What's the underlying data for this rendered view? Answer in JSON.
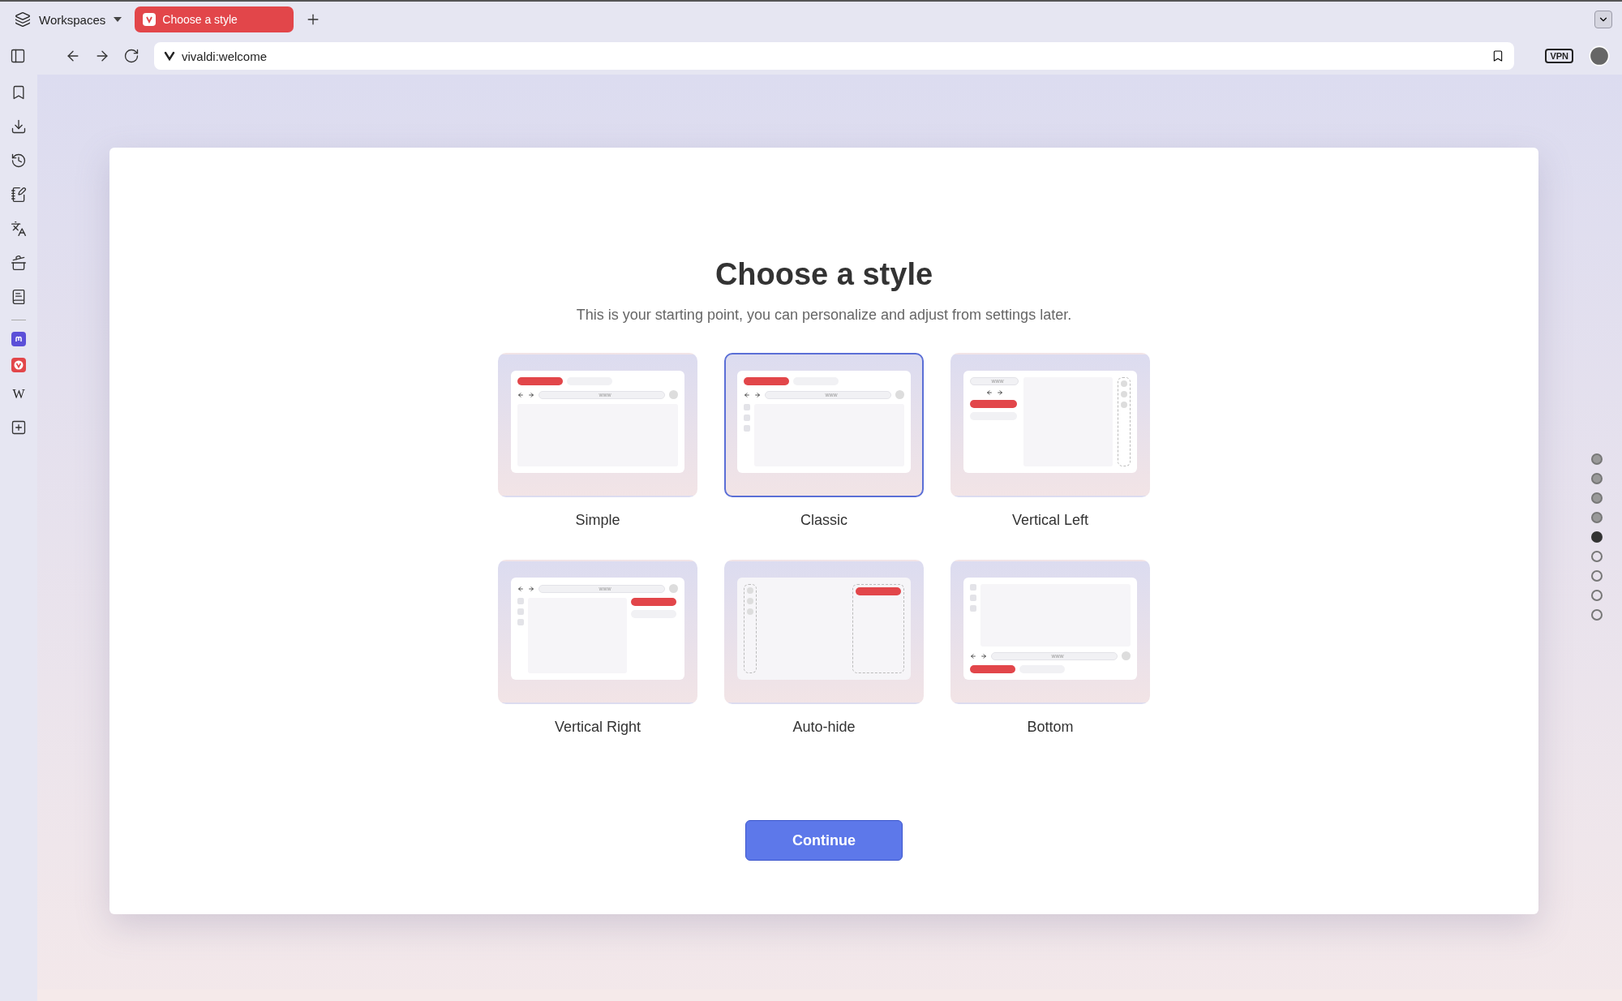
{
  "tab_bar": {
    "workspaces_label": "Workspaces",
    "tabs": [
      {
        "title": "Choose a style",
        "selected": true
      }
    ]
  },
  "address_bar": {
    "url": "vivaldi:welcome",
    "vpn_label": "VPN"
  },
  "web_panels": [
    {
      "kind": "mastodon"
    },
    {
      "kind": "vivaldi"
    },
    {
      "kind": "glyph",
      "glyph": "W"
    }
  ],
  "dialog": {
    "title": "Choose a style",
    "subtitle": "This is your starting point, you can personalize and adjust from settings later.",
    "styles": [
      {
        "name": "Simple",
        "kind": "simple",
        "selected": false,
        "url_hint": "www"
      },
      {
        "name": "Classic",
        "kind": "classic",
        "selected": true,
        "url_hint": "www"
      },
      {
        "name": "Vertical Left",
        "kind": "vertical_left",
        "selected": false,
        "url_hint": "www"
      },
      {
        "name": "Vertical Right",
        "kind": "vertical_right",
        "selected": false,
        "url_hint": "www"
      },
      {
        "name": "Auto-hide",
        "kind": "autohide",
        "selected": false
      },
      {
        "name": "Bottom",
        "kind": "bottom",
        "selected": false,
        "url_hint": "www"
      }
    ],
    "button": "Continue"
  },
  "steps": [
    {
      "selected": false,
      "visited": true
    },
    {
      "selected": false,
      "visited": true
    },
    {
      "selected": false,
      "visited": true
    },
    {
      "selected": false,
      "visited": true
    },
    {
      "selected": true,
      "visited": true
    },
    {
      "selected": false,
      "visited": false
    },
    {
      "selected": false,
      "visited": false
    },
    {
      "selected": false,
      "visited": false
    },
    {
      "selected": false,
      "visited": false
    }
  ]
}
